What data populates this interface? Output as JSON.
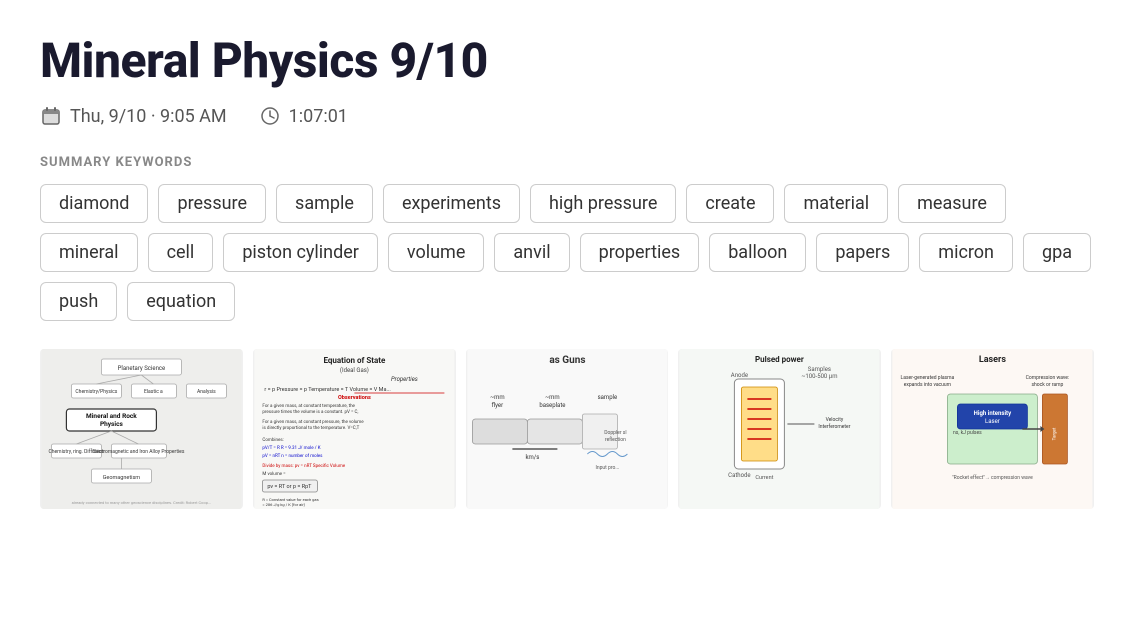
{
  "header": {
    "title": "Mineral Physics 9/10",
    "date": "Thu, 9/10 · 9:05 AM",
    "duration": "1:07:01"
  },
  "section_label": "SUMMARY KEYWORDS",
  "keywords": [
    "diamond",
    "pressure",
    "sample",
    "experiments",
    "high pressure",
    "create",
    "material",
    "measure",
    "mineral",
    "cell",
    "piston cylinder",
    "volume",
    "anvil",
    "properties",
    "balloon",
    "papers",
    "micron",
    "gpa",
    "push",
    "equation"
  ],
  "images": [
    {
      "label": "Mineral and Rock Physics diagram",
      "bg": "#f0f0ee"
    },
    {
      "label": "Equation of State (Ideal Gas)",
      "bg": "#f5f5f3"
    },
    {
      "label": "as Guns — flyer baseplate sample",
      "bg": "#f8f8f8"
    },
    {
      "label": "Pulsed power — Anode Cathode diagram",
      "bg": "#f5f8f5"
    },
    {
      "label": "Lasers — High intensity laser diagram",
      "bg": "#f8f5f0"
    }
  ]
}
